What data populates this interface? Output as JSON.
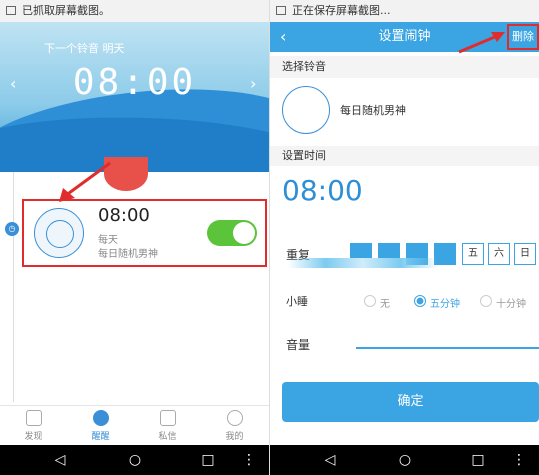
{
  "left_screen": {
    "status_text": "已抓取屏幕截图。",
    "hero": {
      "next_label": "下一个铃音 明天",
      "time": "08:00",
      "prev_arrow": "‹",
      "next_arrow": "›"
    },
    "alarm": {
      "time": "08:00",
      "repeat": "每天",
      "ringtone": "每日随机男神",
      "enabled": true
    },
    "tabs": [
      {
        "label": "发现",
        "icon": "discover-icon"
      },
      {
        "label": "醒醒",
        "icon": "clock-icon",
        "active": true
      },
      {
        "label": "私信",
        "icon": "message-icon"
      },
      {
        "label": "我的",
        "icon": "profile-icon"
      }
    ]
  },
  "right_screen": {
    "status_text": "正在保存屏幕截图...",
    "header": {
      "back": "‹",
      "title": "设置闹钟",
      "delete": "删除"
    },
    "sections": {
      "ringtone": "选择铃音",
      "time": "设置时间"
    },
    "ringtone_name": "每日随机男神",
    "time": "08:00",
    "repeat": {
      "label": "重复",
      "days": [
        "五",
        "六",
        "日"
      ]
    },
    "snooze": {
      "label": "小睡",
      "options": [
        "无",
        "五分钟",
        "十分钟"
      ],
      "selected": "五分钟"
    },
    "volume_label": "音量",
    "confirm": "确定"
  },
  "colors": {
    "accent": "#3ba4e3",
    "highlight": "#e02c2c",
    "toggle_on": "#5cc43a"
  }
}
